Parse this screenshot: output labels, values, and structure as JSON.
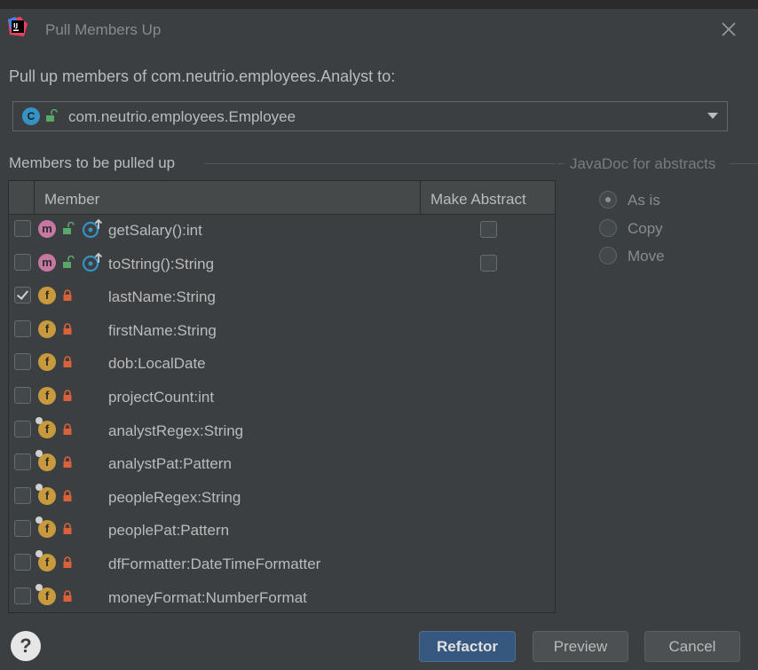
{
  "dialog": {
    "title": "Pull Members Up",
    "heading": "Pull up members of com.neutrio.employees.Analyst to:"
  },
  "target_class": {
    "icon": "class-icon",
    "icon_letter": "C",
    "value": "com.neutrio.employees.Employee"
  },
  "members_section": {
    "label": "Members to be pulled up",
    "columns": {
      "member": "Member",
      "make_abstract": "Make Abstract"
    },
    "rows": [
      {
        "kind": "m",
        "name": "getSalary():int",
        "checked": false,
        "access": "public",
        "override": true,
        "make_abstract": false
      },
      {
        "kind": "m",
        "name": "toString():String",
        "checked": false,
        "access": "public",
        "override": true,
        "make_abstract": false
      },
      {
        "kind": "f",
        "name": "lastName:String",
        "checked": true,
        "access": "private",
        "static": false
      },
      {
        "kind": "f",
        "name": "firstName:String",
        "checked": false,
        "access": "private",
        "static": false
      },
      {
        "kind": "f",
        "name": "dob:LocalDate",
        "checked": false,
        "access": "private",
        "static": false
      },
      {
        "kind": "f",
        "name": "projectCount:int",
        "checked": false,
        "access": "private",
        "static": false
      },
      {
        "kind": "f",
        "name": "analystRegex:String",
        "checked": false,
        "access": "private",
        "static": true
      },
      {
        "kind": "f",
        "name": "analystPat:Pattern",
        "checked": false,
        "access": "private",
        "static": true
      },
      {
        "kind": "f",
        "name": "peopleRegex:String",
        "checked": false,
        "access": "private",
        "static": true
      },
      {
        "kind": "f",
        "name": "peoplePat:Pattern",
        "checked": false,
        "access": "private",
        "static": true
      },
      {
        "kind": "f",
        "name": "dfFormatter:DateTimeFormatter",
        "checked": false,
        "access": "private",
        "static": true
      },
      {
        "kind": "f",
        "name": "moneyFormat:NumberFormat",
        "checked": false,
        "access": "private",
        "static": true
      }
    ]
  },
  "javadoc": {
    "label": "JavaDoc for abstracts",
    "options": [
      {
        "label": "As is",
        "selected": true
      },
      {
        "label": "Copy",
        "selected": false
      },
      {
        "label": "Move",
        "selected": false
      }
    ]
  },
  "buttons": {
    "help": "?",
    "refactor": "Refactor",
    "preview": "Preview",
    "cancel": "Cancel"
  },
  "colors": {
    "background": "#3c3f41",
    "method_icon": "#c678a3",
    "field_icon": "#c99a3d",
    "class_icon": "#3592c4",
    "primary_button": "#365880"
  }
}
